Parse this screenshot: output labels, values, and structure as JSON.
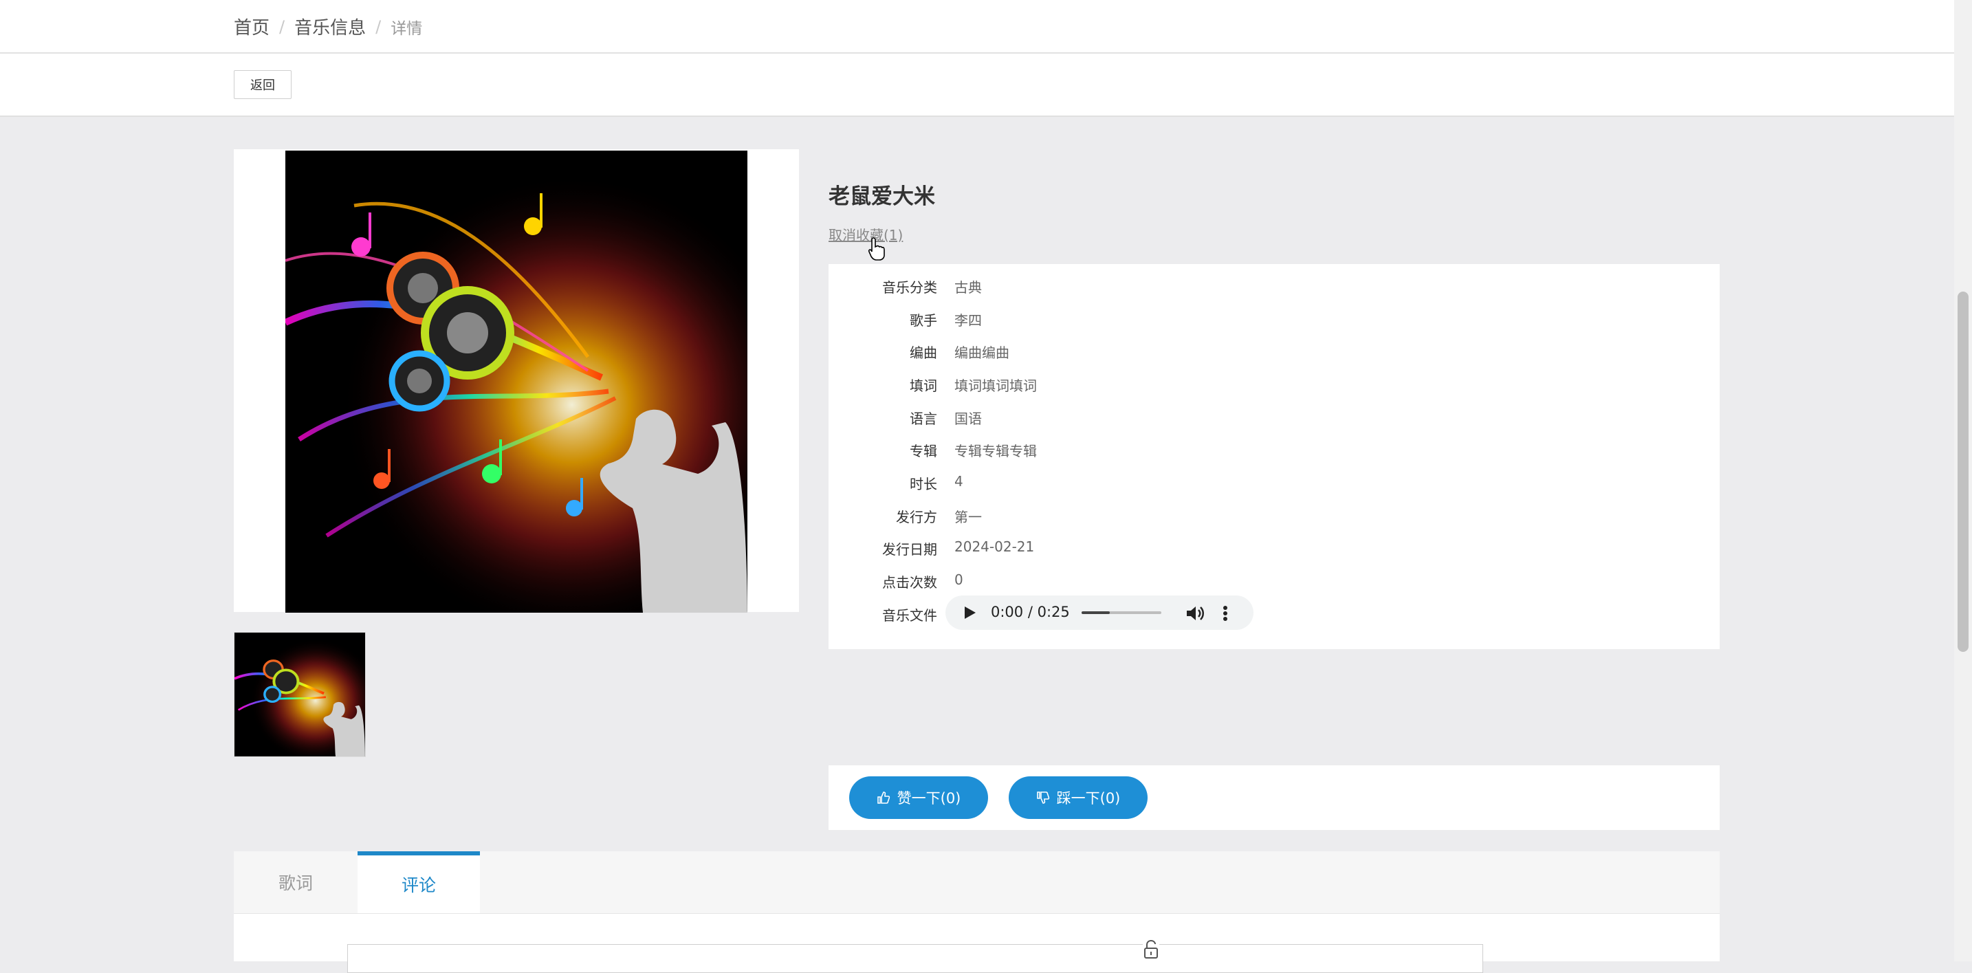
{
  "breadcrumb": {
    "home": "首页",
    "section": "音乐信息",
    "current": "详情",
    "separator": "/"
  },
  "back_button": "返回",
  "song": {
    "title": "老鼠爱大米",
    "favorite_link": "取消收藏(1)"
  },
  "details": [
    {
      "label": "音乐分类",
      "value": "古典"
    },
    {
      "label": "歌手",
      "value": "李四"
    },
    {
      "label": "编曲",
      "value": "编曲编曲"
    },
    {
      "label": "填词",
      "value": "填词填词填词"
    },
    {
      "label": "语言",
      "value": "国语"
    },
    {
      "label": "专辑",
      "value": "专辑专辑专辑"
    },
    {
      "label": "时长",
      "value": "4"
    },
    {
      "label": "发行方",
      "value": "第一"
    },
    {
      "label": "发行日期",
      "value": "2024-02-21"
    },
    {
      "label": "点击次数",
      "value": "0"
    },
    {
      "label": "音乐文件",
      "value": ""
    }
  ],
  "audio_player": {
    "time": "0:00 / 0:25",
    "volume_level": 0.35,
    "icons": [
      "play-icon",
      "volume-icon",
      "more-options-icon"
    ]
  },
  "votes": {
    "like_label": "赞一下(0)",
    "dislike_label": "踩一下(0)"
  },
  "tabs": [
    {
      "label": "歌词",
      "active": false
    },
    {
      "label": "评论",
      "active": true
    }
  ],
  "colors": {
    "accent": "#1e8fd6",
    "tab_active": "#1e88c8",
    "page_bg": "#ececee"
  }
}
